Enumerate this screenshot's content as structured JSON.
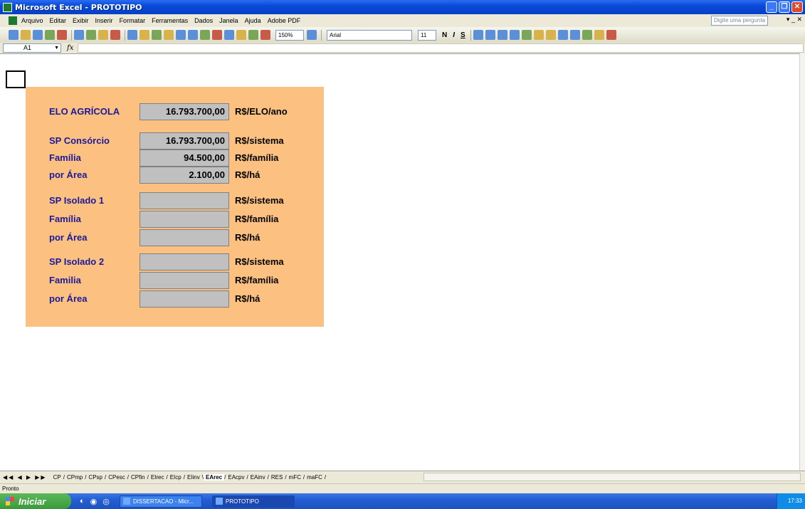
{
  "window": {
    "title": "Microsoft Excel - PROTOTIPO"
  },
  "menu": {
    "items": [
      "Arquivo",
      "Editar",
      "Exibir",
      "Inserir",
      "Formatar",
      "Ferramentas",
      "Dados",
      "Janela",
      "Ajuda",
      "Adobe PDF"
    ],
    "ask_placeholder": "Digite uma pergunta"
  },
  "toolbar": {
    "zoom": "150%",
    "font": "Arial",
    "size": "11",
    "bold": "N",
    "italic": "I",
    "underline": "S"
  },
  "formula_bar": {
    "name_box": "A1",
    "fx": "fx",
    "value": ""
  },
  "panel": {
    "fill_color": "#fcc080",
    "rows": [
      {
        "label": "ELO AGRÍCOLA",
        "value": "16.793.700,00",
        "unit": "R$/ELO/ano"
      },
      {
        "label": "SP Consórcio",
        "value": "16.793.700,00",
        "unit": "R$/sistema"
      },
      {
        "label": "Família",
        "value": "94.500,00",
        "unit": "R$/família"
      },
      {
        "label": "por Área",
        "value": "2.100,00",
        "unit": "R$/há"
      },
      {
        "label": "SP Isolado 1",
        "value": "",
        "unit": "R$/sistema"
      },
      {
        "label": "Família",
        "value": "",
        "unit": "R$/família"
      },
      {
        "label": "por Área",
        "value": "",
        "unit": "R$/há"
      },
      {
        "label": "SP Isolado 2",
        "value": "",
        "unit": "R$/sistema"
      },
      {
        "label": "Familia",
        "value": "",
        "unit": "R$/família"
      },
      {
        "label": "por Área",
        "value": "",
        "unit": "R$/há"
      }
    ]
  },
  "sheet_tabs": [
    "CP",
    "CPmp",
    "CPsp",
    "CPesc",
    "CPfin",
    "EIrec",
    "EIcp",
    "EIinv",
    "EArec",
    "EAcpv",
    "EAinv",
    "RES",
    "mFC",
    "maFC"
  ],
  "active_tab": "EArec",
  "status": "Pronto",
  "taskbar": {
    "start": "Iniciar",
    "items": [
      "DISSERTACAO - Micr...",
      "PROTOTIPO"
    ],
    "clock": "17:33"
  }
}
